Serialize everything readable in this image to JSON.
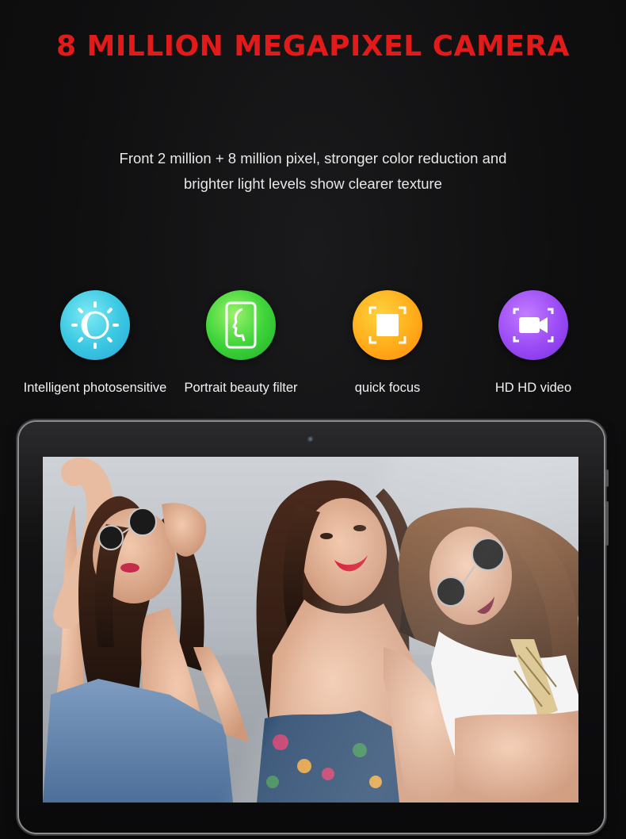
{
  "headline": "8 MILLION MEGAPIXEL CAMERA",
  "subtitle": {
    "line1": "Front 2 million + 8 million pixel, stronger color reduction and",
    "line2": "brighter light levels show clearer texture"
  },
  "features": [
    {
      "label": "Intelligent photosensitive",
      "icon": "brightness-icon",
      "color": "#3cc9e3"
    },
    {
      "label": "Portrait beauty filter",
      "icon": "portrait-icon",
      "color": "#3fd43a"
    },
    {
      "label": "quick focus",
      "icon": "focus-icon",
      "color": "#ffac1a"
    },
    {
      "label": "HD HD video",
      "icon": "video-camera-icon",
      "color": "#9a4af5"
    }
  ],
  "colors": {
    "accent": "#e11a1a",
    "background": "#0e0e0f",
    "text": "#e8e8e8"
  }
}
